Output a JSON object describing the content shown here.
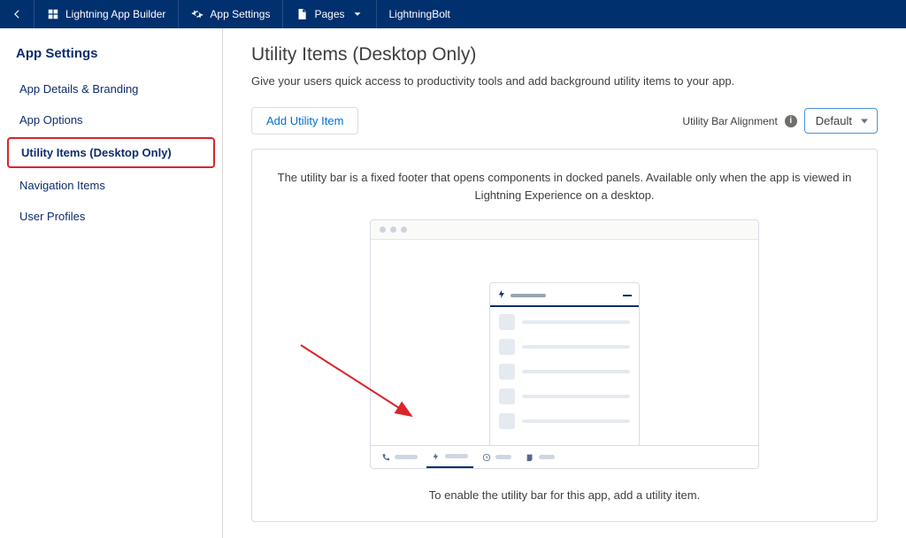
{
  "topnav": {
    "builder": "Lightning App Builder",
    "appSettings": "App Settings",
    "pages": "Pages",
    "appName": "LightningBolt"
  },
  "sidebar": {
    "heading": "App Settings",
    "items": [
      {
        "label": "App Details & Branding",
        "selected": false
      },
      {
        "label": "App Options",
        "selected": false
      },
      {
        "label": "Utility Items (Desktop Only)",
        "selected": true
      },
      {
        "label": "Navigation Items",
        "selected": false
      },
      {
        "label": "User Profiles",
        "selected": false
      }
    ]
  },
  "main": {
    "title": "Utility Items (Desktop Only)",
    "subtitle": "Give your users quick access to productivity tools and add background utility items to your app.",
    "addButton": "Add Utility Item",
    "alignLabel": "Utility Bar Alignment",
    "alignValue": "Default",
    "panelDescription": "The utility bar is a fixed footer that opens components in docked panels. Available only when the app is viewed in Lightning Experience on a desktop.",
    "panelFootnote": "To enable the utility bar for this app, add a utility item."
  }
}
